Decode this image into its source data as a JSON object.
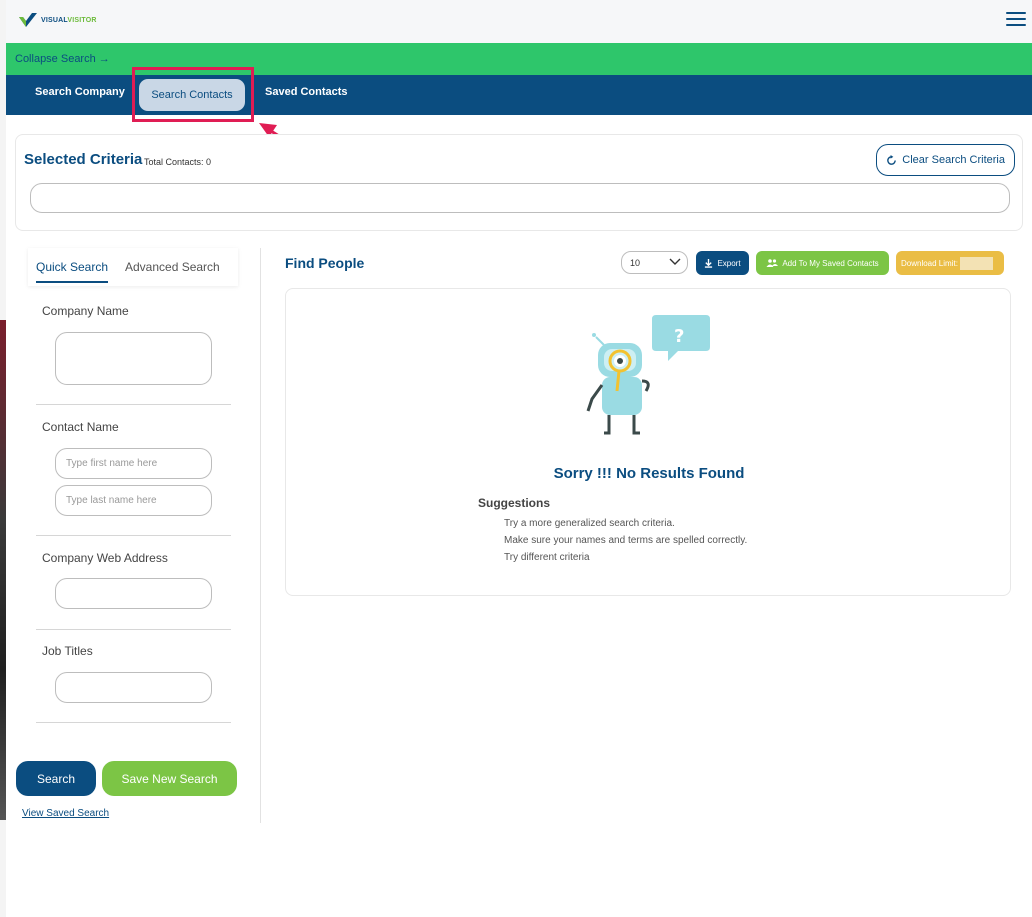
{
  "app": {
    "brand_part1": "VISUAL",
    "brand_part2": "VISITOR"
  },
  "collapse": {
    "label": "Collapse Search →"
  },
  "nav": {
    "tabs": [
      {
        "label": "Search Company"
      },
      {
        "label": "Search Contacts"
      },
      {
        "label": "Saved Contacts"
      }
    ],
    "active_tab": "Search Contacts"
  },
  "criteria": {
    "title": "Selected Criteria",
    "total_contacts": "Total Contacts: 0",
    "clear_label": "Clear Search Criteria"
  },
  "search_panel": {
    "tabs": {
      "quick": "Quick Search",
      "advanced": "Advanced Search"
    },
    "company_name_label": "Company Name",
    "contact_name_label": "Contact Name",
    "first_name_placeholder": "Type first name here",
    "last_name_placeholder": "Type last name here",
    "web_address_label": "Company Web Address",
    "job_titles_label": "Job Titles",
    "search_button": "Search",
    "save_search_button": "Save New Search",
    "view_saved_link": "View Saved Search"
  },
  "results": {
    "title": "Find People",
    "per_page": "10",
    "export_label": "Export",
    "add_saved_label": "Add To My Saved Contacts",
    "download_limit_label": "Download Limit:",
    "empty_title": "Sorry !!! No Results Found",
    "suggestions_title": "Suggestions",
    "suggestions": [
      "Try a more generalized search criteria.",
      "Make sure your names and terms are spelled correctly.",
      "Try different criteria"
    ]
  },
  "colors": {
    "primary": "#0b4d80",
    "green_bar": "#2ec66b",
    "green_button": "#7cc545",
    "yellow_button": "#eabd45",
    "highlight": "#e01d54"
  }
}
